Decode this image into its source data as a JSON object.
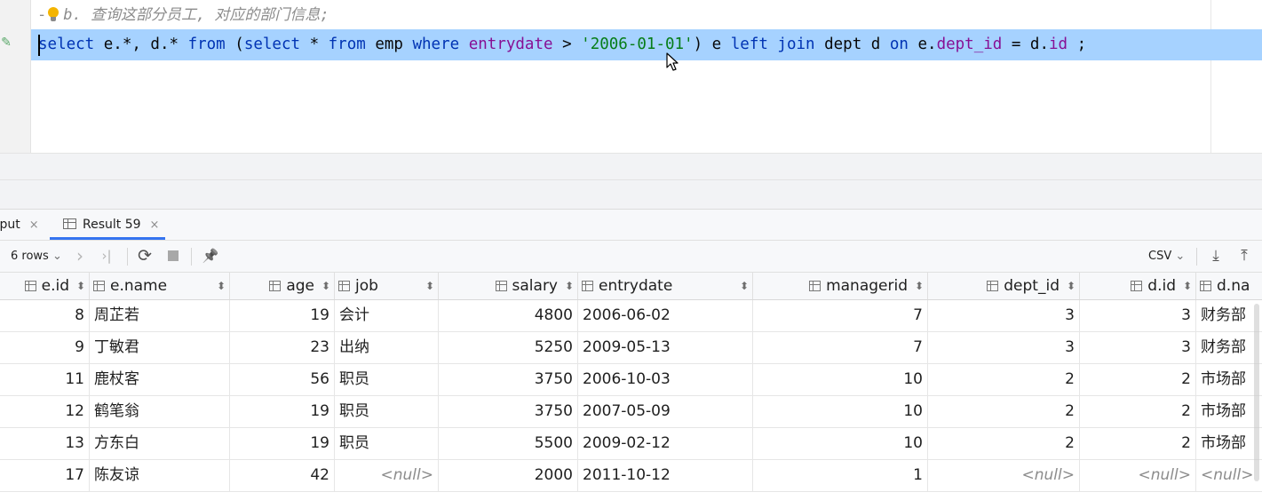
{
  "editor": {
    "comment": "b. 查询这部分员工, 对应的部门信息;",
    "comment_dash": "-",
    "sql_tokens": [
      {
        "t": "select",
        "c": "kw"
      },
      {
        "t": " e.*, d.* ",
        "c": ""
      },
      {
        "t": "from",
        "c": "kw"
      },
      {
        "t": " (",
        "c": ""
      },
      {
        "t": "select",
        "c": "kw"
      },
      {
        "t": " * ",
        "c": ""
      },
      {
        "t": "from",
        "c": "kw"
      },
      {
        "t": " emp ",
        "c": ""
      },
      {
        "t": "where",
        "c": "kw"
      },
      {
        "t": " ",
        "c": ""
      },
      {
        "t": "entrydate",
        "c": "id"
      },
      {
        "t": " > ",
        "c": ""
      },
      {
        "t": "'2006-01-01'",
        "c": "str"
      },
      {
        "t": ") e ",
        "c": ""
      },
      {
        "t": "left join",
        "c": "kw"
      },
      {
        "t": " dept d ",
        "c": ""
      },
      {
        "t": "on",
        "c": "kw"
      },
      {
        "t": " e.",
        "c": ""
      },
      {
        "t": "dept_id",
        "c": "id"
      },
      {
        "t": " = d.",
        "c": ""
      },
      {
        "t": "id",
        "c": "id"
      },
      {
        "t": " ;",
        "c": ""
      }
    ]
  },
  "tabs": {
    "output_label": "tput",
    "result_label": "Result 59",
    "close_glyph": "×"
  },
  "toolbar": {
    "rows_label": "6 rows",
    "rows_chevron": "⌄",
    "next_glyph": "›",
    "last_glyph": "›|",
    "refresh_glyph": "⟳",
    "pin_glyph": "📌",
    "export_format": "CSV",
    "export_chevron": "⌄",
    "download_glyph": "⤓",
    "upload_glyph": "⤒"
  },
  "grid": {
    "sort_glyph": "⬍",
    "columns": [
      "e.id",
      "e.name",
      "age",
      "job",
      "salary",
      "entrydate",
      "managerid",
      "dept_id",
      "d.id",
      "d.na"
    ],
    "rows": [
      [
        "8",
        "周芷若",
        "19",
        "会计",
        "4800",
        "2006-06-02",
        "7",
        "3",
        "3",
        "财务部"
      ],
      [
        "9",
        "丁敏君",
        "23",
        "出纳",
        "5250",
        "2009-05-13",
        "7",
        "3",
        "3",
        "财务部"
      ],
      [
        "11",
        "鹿杖客",
        "56",
        "职员",
        "3750",
        "2006-10-03",
        "10",
        "2",
        "2",
        "市场部"
      ],
      [
        "12",
        "鹤笔翁",
        "19",
        "职员",
        "3750",
        "2007-05-09",
        "10",
        "2",
        "2",
        "市场部"
      ],
      [
        "13",
        "方东白",
        "19",
        "职员",
        "5500",
        "2009-02-12",
        "10",
        "2",
        "2",
        "市场部"
      ],
      [
        "17",
        "陈友谅",
        "42",
        "<null>",
        "2000",
        "2011-10-12",
        "1",
        "<null>",
        "<null>",
        "<null>"
      ]
    ]
  }
}
